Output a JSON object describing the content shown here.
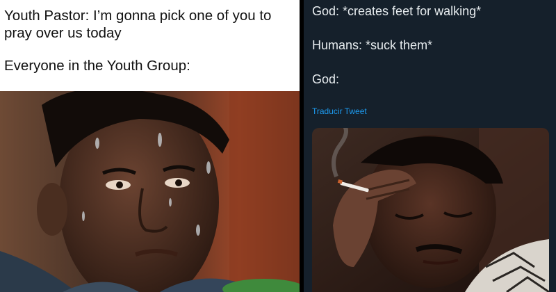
{
  "left_meme": {
    "caption_line1": "Youth Pastor: I’m gonna pick one of you to pray over us today",
    "caption_line2": "Everyone in the Youth Group:"
  },
  "right_tweet": {
    "line1": "God: *creates feet for walking*",
    "line2": "Humans: *suck them*",
    "line3": "God:",
    "translate_link": "Traducir Tweet"
  },
  "colors": {
    "tweet_background": "#15202b",
    "tweet_text": "#e7ecef",
    "link_blue": "#1d9bf0"
  }
}
